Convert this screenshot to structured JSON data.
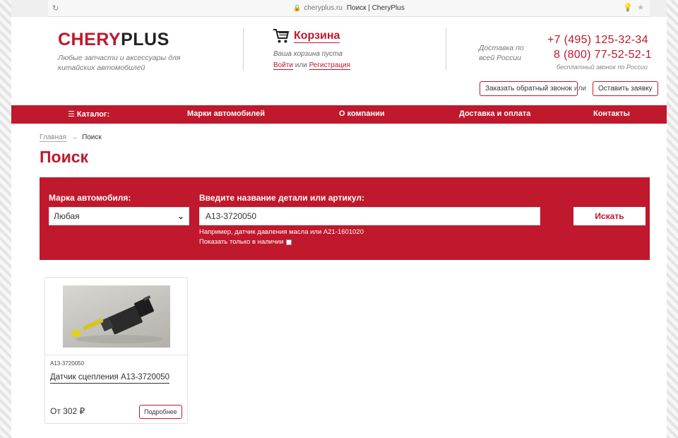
{
  "browser": {
    "domain": "cheryplus.ru",
    "page_title": "Поиск | CheryPlus"
  },
  "header": {
    "logo_part1": "CHERY",
    "logo_part2": "PLUS",
    "tagline": "Любые запчасти и аксессуары для китайских автомобилей",
    "cart_title": "Корзина",
    "cart_status": "Ваша корзина пуста",
    "login_label": "Войти",
    "or_label": "или",
    "register_label": "Регистрация",
    "delivery_note": "Доставка по всей России",
    "phone_1": "+7 (495) 125-32-34",
    "phone_2": "8 (800) 77-52-52-1",
    "free_call_note": "бесплатный звонок по России",
    "callback_button": "Заказать обратный звонок",
    "or_text": "или",
    "request_button": "Оставить заявку"
  },
  "nav": {
    "items": [
      {
        "label": "Каталог:"
      },
      {
        "label": "Марки автомобилей"
      },
      {
        "label": "О компании"
      },
      {
        "label": "Доставка и оплата"
      },
      {
        "label": "Контакты"
      }
    ]
  },
  "breadcrumb": {
    "home": "Главная",
    "arrow": "→",
    "current": "Поиск"
  },
  "page_title": "Поиск",
  "search": {
    "brand_label": "Марка автомобиля:",
    "brand_value": "Любая",
    "query_label": "Введите название детали или артикул:",
    "query_value": "A13-3720050",
    "button_label": "Искать",
    "hint": "Например, датчик давления масла или A21-1601020",
    "stock_label": "Показать только в наличии"
  },
  "product": {
    "sku": "A13-3720050",
    "name": "Датчик сцепления A13-3720050",
    "price": "От 302 ₽",
    "more_button": "Подробнее"
  },
  "colors": {
    "accent": "#c0182c",
    "text": "#333333"
  }
}
